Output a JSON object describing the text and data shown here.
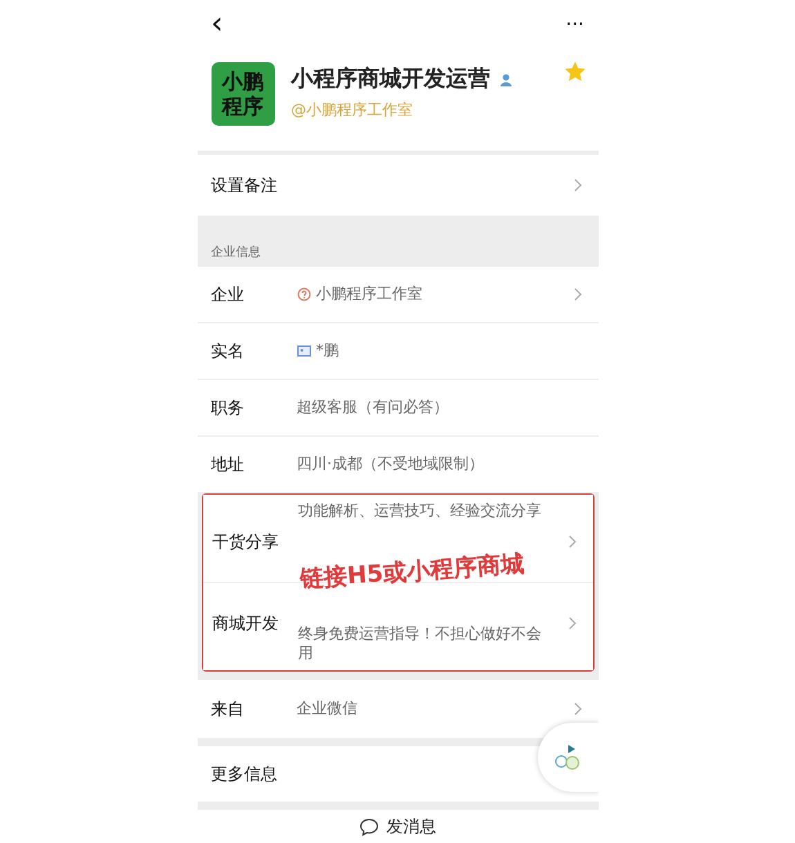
{
  "nav": {
    "back": "‹",
    "more": "···"
  },
  "profile": {
    "name": "小程序商城开发运营",
    "logo_lines": [
      "小鹏",
      "程序"
    ],
    "company": "@小鹏程序工作室",
    "starred": true
  },
  "remark": {
    "label": "设置备注"
  },
  "section": {
    "title": "企业信息"
  },
  "rows": [
    {
      "label": "企业",
      "value": "小鹏程序工作室",
      "kind": "company",
      "arrow": true
    },
    {
      "label": "实名",
      "value": "*鹏",
      "kind": "realname",
      "arrow": false
    },
    {
      "label": "职务",
      "value": "超级客服（有问必答）",
      "kind": "plain",
      "arrow": false
    },
    {
      "label": "地址",
      "value": "四川·成都（不受地域限制）",
      "kind": "plain",
      "arrow": false
    }
  ],
  "highlight_rows": [
    {
      "label": "干货分享",
      "value": "功能解析、运营技巧、经验交流分享",
      "arrow": true
    },
    {
      "label": "商城开发",
      "value": "终身免费运营指导！不担心做好不会用",
      "arrow": true
    }
  ],
  "annotation": "链接H5或小程序商城",
  "source": {
    "label": "来自",
    "value": "企业微信",
    "arrow": true
  },
  "more_info": {
    "label": "更多信息"
  },
  "send": {
    "label": "发消息"
  }
}
